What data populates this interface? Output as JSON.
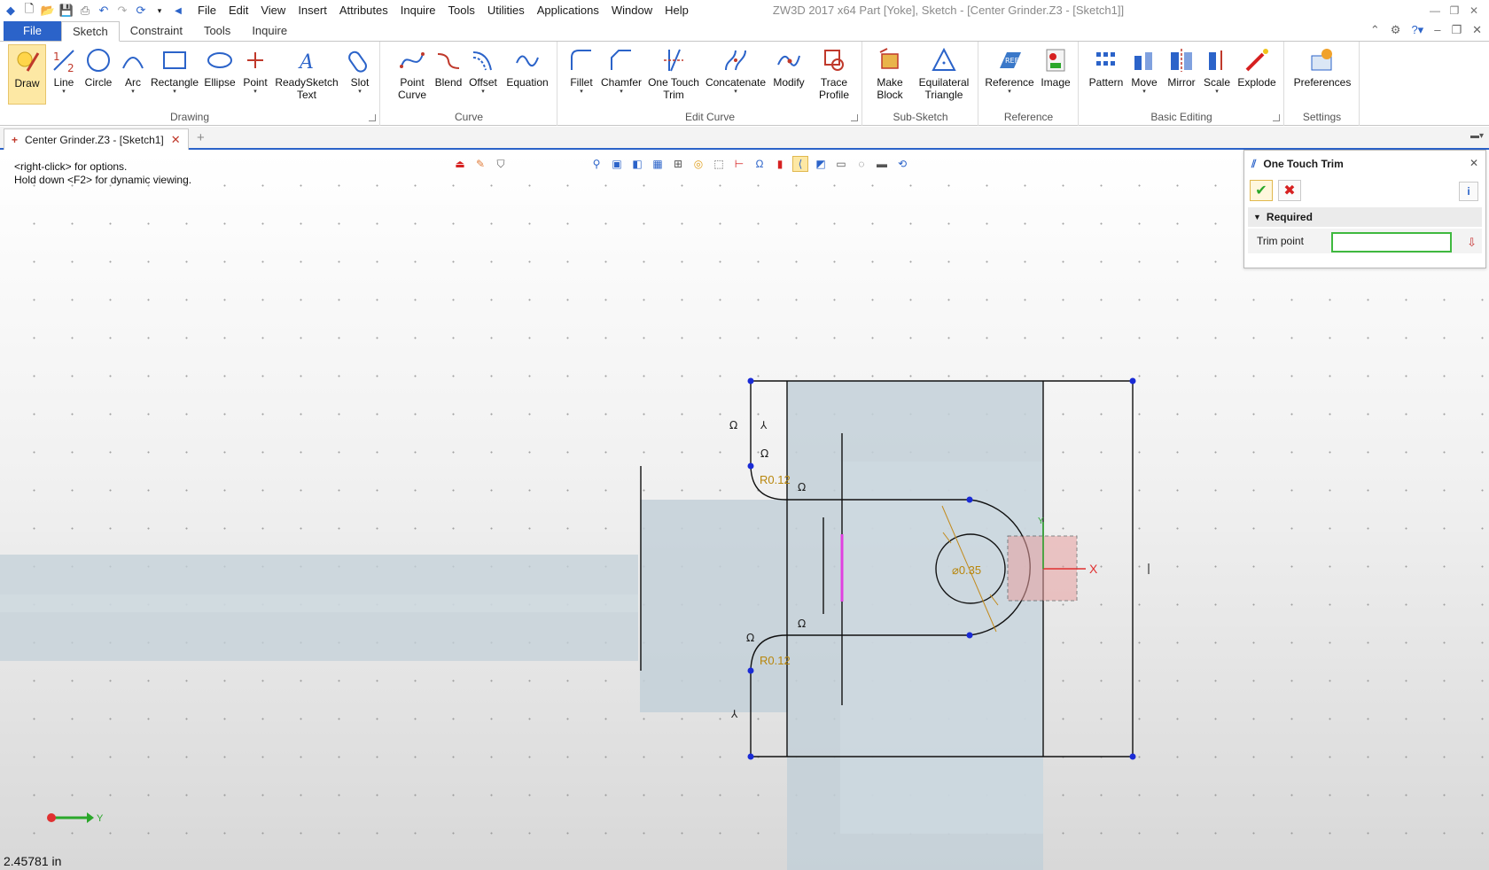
{
  "app": {
    "title": "ZW3D 2017  x64      Part [Yoke],  Sketch - [Center Grinder.Z3 - [Sketch1]]",
    "menus": [
      "File",
      "Edit",
      "View",
      "Insert",
      "Attributes",
      "Inquire",
      "Tools",
      "Utilities",
      "Applications",
      "Window",
      "Help"
    ]
  },
  "ribbon_tabs": [
    "File",
    "Sketch",
    "Constraint",
    "Tools",
    "Inquire"
  ],
  "ribbon": {
    "drawing": {
      "label": "Drawing",
      "buttons": [
        "Draw",
        "Line",
        "Circle",
        "Arc",
        "Rectangle",
        "Ellipse",
        "Point",
        "ReadySketch\nText",
        "Slot"
      ]
    },
    "curve": {
      "label": "Curve",
      "buttons": [
        "Point\nCurve",
        "Blend",
        "Offset",
        "Equation"
      ]
    },
    "edit_curve": {
      "label": "Edit Curve",
      "buttons": [
        "Fillet",
        "Chamfer",
        "One Touch\nTrim",
        "Concatenate",
        "Modify",
        "Trace\nProfile"
      ]
    },
    "sub_sketch": {
      "label": "Sub-Sketch",
      "buttons": [
        "Make\nBlock",
        "Equilateral\nTriangle"
      ]
    },
    "reference": {
      "label": "Reference",
      "buttons": [
        "Reference",
        "Image"
      ]
    },
    "basic_editing": {
      "label": "Basic Editing",
      "buttons": [
        "Pattern",
        "Move",
        "Mirror",
        "Scale",
        "Explode"
      ]
    },
    "settings": {
      "label": "Settings",
      "buttons": [
        "Preferences"
      ]
    }
  },
  "doc_tab": {
    "label": "Center Grinder.Z3 - [Sketch1]"
  },
  "canvas": {
    "hint1": "<right-click> for options.",
    "hint2": "Hold down <F2> for dynamic viewing.",
    "dim_r_top": "R0.12",
    "dim_r_bottom": "R0.12",
    "dim_dia": "⌀0.35",
    "axis_x": "X",
    "axis_y": "Y",
    "status": "2.45781 in"
  },
  "panel": {
    "title": "One Touch Trim",
    "section": "Required",
    "field_label": "Trim point",
    "field_value": ""
  },
  "colors": {
    "accent": "#2b63c9",
    "ok": "#2aa72a",
    "cancel": "#d62020",
    "dimension": "#b8860b"
  }
}
